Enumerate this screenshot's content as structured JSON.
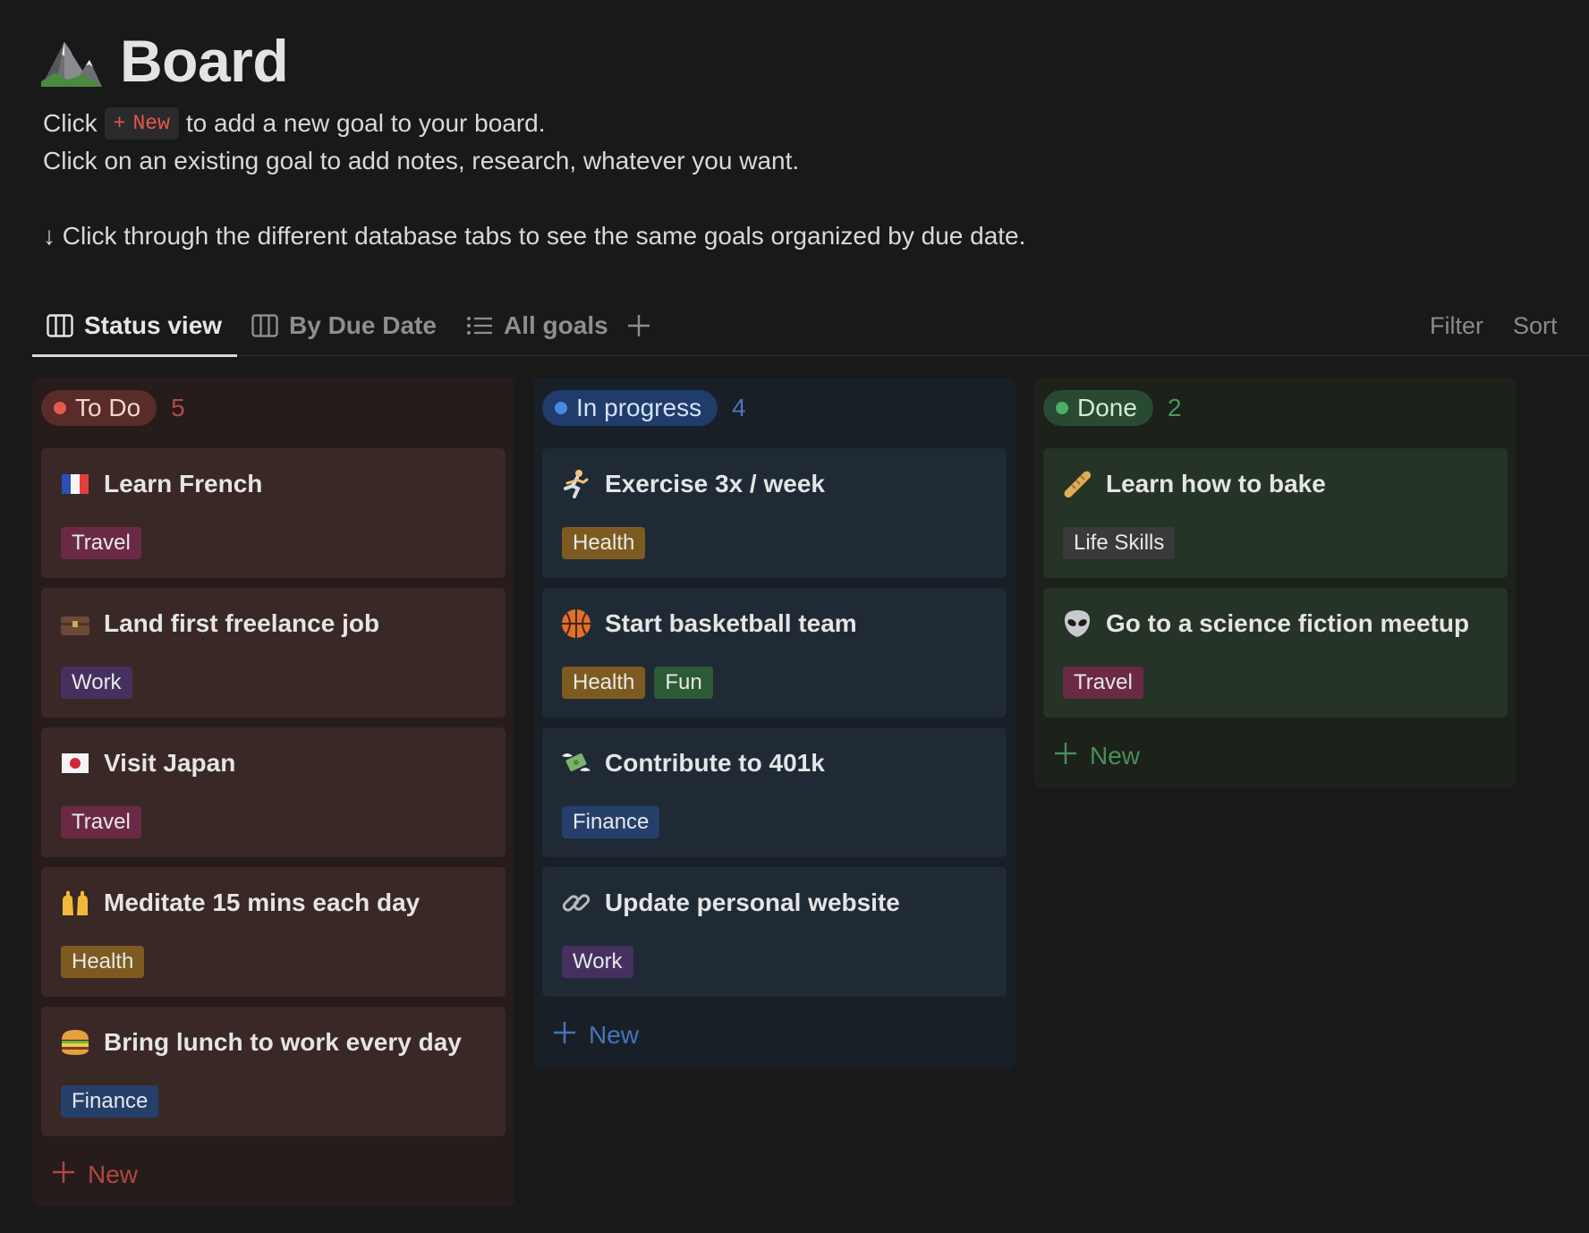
{
  "page": {
    "icon": "mountain-icon",
    "title": "Board",
    "desc_click": "Click",
    "inline_new_label": "New",
    "desc_line1_rest": "to add a new goal to your board.",
    "desc_line2": "Click on an existing goal to add notes, research, whatever you want.",
    "desc_line3": "↓ Click through the different database tabs to see the same goals organized by due date."
  },
  "tabs": [
    {
      "label": "Status view",
      "icon": "board-icon",
      "active": true
    },
    {
      "label": "By Due Date",
      "icon": "board-icon",
      "active": false
    },
    {
      "label": "All goals",
      "icon": "list-icon",
      "active": false
    }
  ],
  "toolbar": {
    "filter": "Filter",
    "sort": "Sort"
  },
  "columns": [
    {
      "status": "To Do",
      "count": "5",
      "color": "#e45a4f",
      "cards": [
        {
          "title": "Learn French",
          "emoji": "france-flag-icon",
          "tags": [
            "Travel"
          ]
        },
        {
          "title": "Land first freelance job",
          "emoji": "briefcase-icon",
          "tags": [
            "Work"
          ]
        },
        {
          "title": "Visit Japan",
          "emoji": "japan-flag-icon",
          "tags": [
            "Travel"
          ]
        },
        {
          "title": "Meditate 15 mins each day",
          "emoji": "raised-hands-icon",
          "tags": [
            "Health"
          ]
        },
        {
          "title": "Bring lunch to work every day",
          "emoji": "burger-icon",
          "tags": [
            "Finance"
          ]
        }
      ],
      "new_label": "New"
    },
    {
      "status": "In progress",
      "count": "4",
      "color": "#4a86e8",
      "cards": [
        {
          "title": "Exercise 3x / week",
          "emoji": "runner-icon",
          "tags": [
            "Health"
          ]
        },
        {
          "title": "Start basketball team",
          "emoji": "basketball-icon",
          "tags": [
            "Health",
            "Fun"
          ]
        },
        {
          "title": "Contribute to 401k",
          "emoji": "money-wings-icon",
          "tags": [
            "Finance"
          ]
        },
        {
          "title": "Update personal website",
          "emoji": "link-icon",
          "tags": [
            "Work"
          ]
        }
      ],
      "new_label": "New"
    },
    {
      "status": "Done",
      "count": "2",
      "color": "#4caf62",
      "cards": [
        {
          "title": "Learn how to bake",
          "emoji": "baguette-icon",
          "tags": [
            "Life Skills"
          ]
        },
        {
          "title": "Go to a science fiction meetup",
          "emoji": "alien-icon",
          "tags": [
            "Travel"
          ]
        }
      ],
      "new_label": "New"
    }
  ]
}
